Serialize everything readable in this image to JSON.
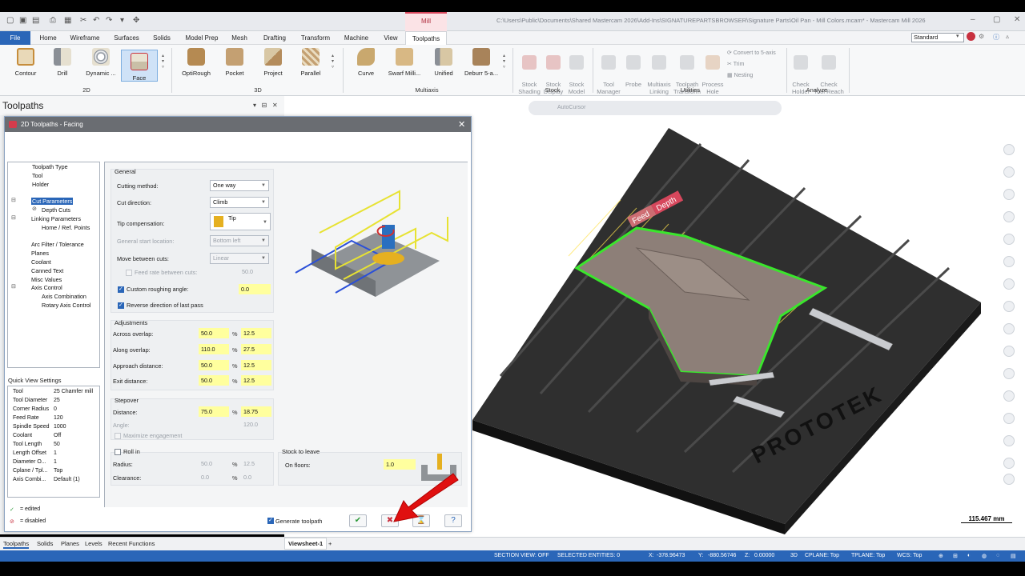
{
  "window": {
    "context_tab": "Mill",
    "title": "C:\\Users\\Public\\Documents\\Shared Mastercam 2026\\Add-Ins\\SIGNATUREPARTSBROWSER\\Signature Parts\\Oil Pan - Mill Colors.mcam* - Mastercam Mill 2026",
    "workspace": "Standard"
  },
  "menu": [
    "File",
    "Home",
    "Wireframe",
    "Surfaces",
    "Solids",
    "Model Prep",
    "Mesh",
    "Drafting",
    "Transform",
    "Machine",
    "View",
    "Toolpaths"
  ],
  "ribbon": {
    "g2d": {
      "label": "2D",
      "items": [
        "Contour",
        "Drill",
        "Dynamic ...",
        "Face"
      ]
    },
    "g3d": {
      "label": "3D",
      "items": [
        "OptiRough",
        "Pocket",
        "Project",
        "Parallel"
      ]
    },
    "multiaxis": {
      "label": "Multiaxis",
      "items": [
        "Curve",
        "Swarf Milli...",
        "Unified",
        "Deburr 5-a..."
      ]
    },
    "stock": {
      "label": "Stock",
      "items": [
        "Stock\nShading",
        "Stock\nDisplay",
        "Stock\nModel"
      ]
    },
    "utilities": {
      "label": "Utilities",
      "items": [
        "Tool\nManager",
        "Probe",
        "Multiaxis\nLinking",
        "Toolpath\nTransform",
        "Process\nHole"
      ],
      "small": [
        "Convert to 5-axis",
        "Trim",
        "Nesting"
      ]
    },
    "analyze": {
      "label": "Analyze",
      "items": [
        "Check\nHolder",
        "Check\nTool Reach"
      ]
    }
  },
  "panel": {
    "title": "Toolpaths"
  },
  "dialog": {
    "title": "2D Toolpaths - Facing",
    "tree": [
      {
        "label": "Toolpath Type",
        "level": 1
      },
      {
        "label": "Tool",
        "level": 1
      },
      {
        "label": "Holder",
        "level": 1
      },
      {
        "label": "Cut Parameters",
        "level": 1
      },
      {
        "label": "Depth Cuts",
        "level": 2
      },
      {
        "label": "Linking Parameters",
        "level": 1
      },
      {
        "label": "Home / Ref. Points",
        "level": 2
      },
      {
        "label": "Arc Filter / Tolerance",
        "level": 1
      },
      {
        "label": "Planes",
        "level": 1
      },
      {
        "label": "Coolant",
        "level": 1
      },
      {
        "label": "Canned Text",
        "level": 1
      },
      {
        "label": "Misc Values",
        "level": 1
      },
      {
        "label": "Axis Control",
        "level": 1
      },
      {
        "label": "Axis Combination",
        "level": 2
      },
      {
        "label": "Rotary Axis Control",
        "level": 2
      }
    ],
    "quick_view_title": "Quick View Settings",
    "quick_view": [
      [
        "Tool",
        "25 Chamfer mill"
      ],
      [
        "Tool Diameter",
        "25"
      ],
      [
        "Corner Radius",
        "0"
      ],
      [
        "Feed Rate",
        "120"
      ],
      [
        "Spindle Speed",
        "1000"
      ],
      [
        "Coolant",
        "Off"
      ],
      [
        "Tool Length",
        "50"
      ],
      [
        "Length Offset",
        "1"
      ],
      [
        "Diameter O...",
        "1"
      ],
      [
        "Cplane / Tpl...",
        "Top"
      ],
      [
        "Axis Combi...",
        "Default (1)"
      ]
    ],
    "legend_edited": "= edited",
    "legend_disabled": "= disabled",
    "general": {
      "title": "General",
      "cutting_method_label": "Cutting method:",
      "cutting_method": "One way",
      "cut_direction_label": "Cut direction:",
      "cut_direction": "Climb",
      "tip_comp_label": "Tip compensation:",
      "tip_comp": "Tip",
      "start_loc_label": "General start location:",
      "start_loc": "Bottom left",
      "move_between_label": "Move between cuts:",
      "move_between": "Linear",
      "feed_between_label": "Feed rate between cuts:",
      "feed_between": "50.0",
      "custom_angle_label": "Custom roughing angle:",
      "custom_angle": "0.0",
      "reverse_label": "Reverse direction of last pass"
    },
    "adjustments": {
      "title": "Adjustments",
      "rows": [
        {
          "label": "Across overlap:",
          "pct": "50.0",
          "val": "12.5"
        },
        {
          "label": "Along overlap:",
          "pct": "110.0",
          "val": "27.5"
        },
        {
          "label": "Approach distance:",
          "pct": "50.0",
          "val": "12.5"
        },
        {
          "label": "Exit distance:",
          "pct": "50.0",
          "val": "12.5"
        }
      ]
    },
    "stepover": {
      "title": "Stepover",
      "distance_label": "Distance:",
      "distance_pct": "75.0",
      "distance_val": "18.75",
      "angle_label": "Angle:",
      "angle": "120.0",
      "maximize_label": "Maximize engagement"
    },
    "roll_in": {
      "title": "Roll in",
      "radius_label": "Radius:",
      "radius_pct": "50.0",
      "radius_val": "12.5",
      "clearance_label": "Clearance:",
      "clearance_pct": "0.0",
      "clearance_val": "0.0"
    },
    "stock_to_leave": {
      "title": "Stock to leave",
      "floors_label": "On floors:",
      "floors": "1.0"
    },
    "generate_label": "Generate toolpath"
  },
  "viewport": {
    "autocursor": "AutoCursor",
    "overlay_feed": "Feed",
    "overlay_depth": "Depth",
    "brand": "PROTOTEK",
    "scale": "115.467 mm"
  },
  "bottom_tabs": [
    "Toolpaths",
    "Solids",
    "Planes",
    "Levels",
    "Recent Functions"
  ],
  "viewsheet": "Viewsheet-1",
  "status": {
    "section_view": "SECTION VIEW: OFF",
    "selected": "SELECTED ENTITIES: 0",
    "x_label": "X:",
    "x": "-378.96473",
    "y_label": "Y:",
    "y": "-880.56746",
    "z_label": "Z:",
    "z": "0.00000",
    "mode": "3D",
    "cplane": "CPLANE: Top",
    "tplane": "TPLANE: Top",
    "wcs": "WCS: Top"
  },
  "colors": {
    "accent": "#2a66b8",
    "mill": "#d6475c",
    "toolpath_green": "#38e02c",
    "highlight": "#ffff9e"
  }
}
